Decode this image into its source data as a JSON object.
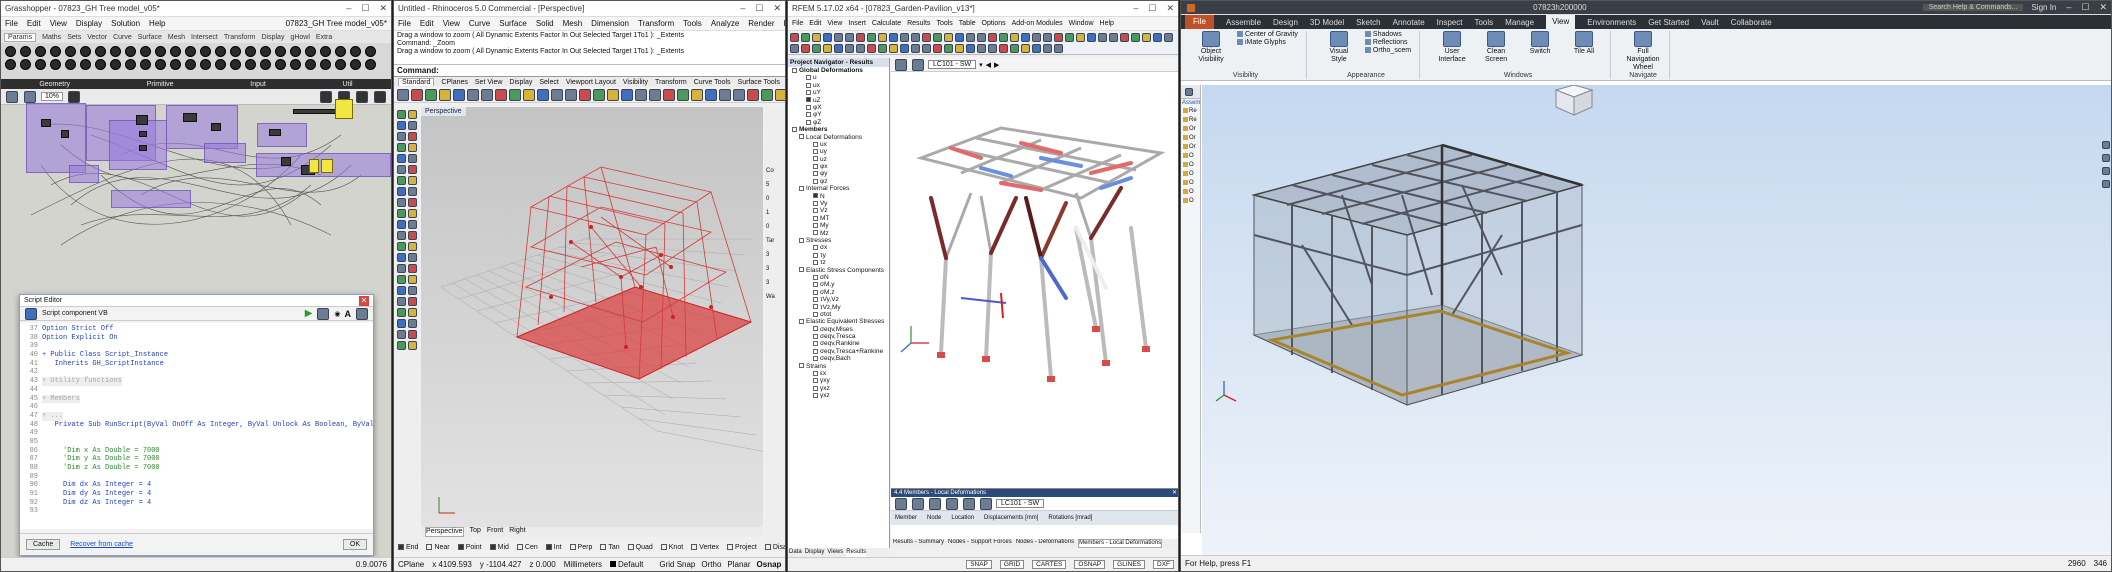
{
  "gh": {
    "title": "Grasshopper - 07823_GH Tree model_v05*",
    "doc": "07823_GH Tree model_v05*",
    "menu": [
      "File",
      "Edit",
      "View",
      "Display",
      "Solution",
      "Help"
    ],
    "tabs": [
      "Params",
      "Maths",
      "Sets",
      "Vector",
      "Curve",
      "Surface",
      "Mesh",
      "Intersect",
      "Transform",
      "Display",
      "gHowl",
      "Extra"
    ],
    "groups": [
      "Geometry",
      "Primitive",
      "Input",
      "Util"
    ],
    "zoom": "10%",
    "version": "0.9.0076"
  },
  "script": {
    "title": "Script Editor",
    "component": "Script component  VB",
    "lines": [
      {
        "n": "37",
        "t": "Option Strict Off",
        "c": ""
      },
      {
        "n": "38",
        "t": "Option Explicit On",
        "c": ""
      },
      {
        "n": "39",
        "t": "",
        "c": ""
      },
      {
        "n": "40",
        "t": "+ Public Class Script_Instance",
        "c": ""
      },
      {
        "n": "41",
        "t": "   Inherits GH_ScriptInstance",
        "c": ""
      },
      {
        "n": "42",
        "t": "",
        "c": ""
      },
      {
        "n": "43",
        "t": "+ Utility functions",
        "c": "f"
      },
      {
        "n": "44",
        "t": "",
        "c": ""
      },
      {
        "n": "45",
        "t": "+ Members",
        "c": "f"
      },
      {
        "n": "46",
        "t": "",
        "c": ""
      },
      {
        "n": "47",
        "t": "+ ...",
        "c": "f"
      },
      {
        "n": "48",
        "t": "   Private Sub RunScript(ByVal OnOff As Integer, ByVal Unlock As Boolean, ByVal Clear As Boolean, By",
        "c": ""
      },
      {
        "n": "49",
        "t": "",
        "c": ""
      },
      {
        "n": "85",
        "t": "",
        "c": ""
      },
      {
        "n": "86",
        "t": "     'Dim x As Double = 7000",
        "c": "c"
      },
      {
        "n": "87",
        "t": "     'Dim y As Double = 7000",
        "c": "c"
      },
      {
        "n": "88",
        "t": "     'Dim z As Double = 7000",
        "c": "c"
      },
      {
        "n": "89",
        "t": "",
        "c": ""
      },
      {
        "n": "90",
        "t": "     Dim dx As Integer = 4",
        "c": ""
      },
      {
        "n": "91",
        "t": "     Dim dy As Integer = 4",
        "c": ""
      },
      {
        "n": "92",
        "t": "     Dim dz As Integer = 4",
        "c": ""
      },
      {
        "n": "93",
        "t": "",
        "c": ""
      }
    ],
    "cache": "Cache",
    "recover": "Recover from cache",
    "ok": "OK"
  },
  "rhino": {
    "title": "Untitled - Rhinoceros 5.0 Commercial - [Perspective]",
    "menu": [
      "File",
      "Edit",
      "View",
      "Curve",
      "Surface",
      "Solid",
      "Mesh",
      "Dimension",
      "Transform",
      "Tools",
      "Analyze",
      "Render",
      "Help"
    ],
    "cmdlines": [
      "Drag a window to zoom ( All  Dynamic  Extents  Factor  In  Out  Selected  Target  1To1 ): _Extents",
      "Command: _Zoom",
      "Drag a window to zoom ( All  Dynamic  Extents  Factor  In  Out  Selected  Target  1To1 ): _Extents"
    ],
    "command": "Command:",
    "tabs": [
      "Standard",
      "CPlanes",
      "Set View",
      "Display",
      "Select",
      "Viewport Layout",
      "Visibility",
      "Transform",
      "Curve Tools",
      "Surface Tools",
      "Solid Tools",
      "Mesh Tools",
      "Render Tools",
      "Draf"
    ],
    "viewport": "Perspective",
    "vptabs": [
      "Perspective",
      "Top",
      "Front",
      "Right"
    ],
    "osnaps": [
      {
        "l": "End",
        "on": true
      },
      {
        "l": "Near",
        "on": false
      },
      {
        "l": "Point",
        "on": true
      },
      {
        "l": "Mid",
        "on": true
      },
      {
        "l": "Cen",
        "on": false
      },
      {
        "l": "Int",
        "on": true
      },
      {
        "l": "Perp",
        "on": false
      },
      {
        "l": "Tan",
        "on": false
      },
      {
        "l": "Quad",
        "on": false
      },
      {
        "l": "Knot",
        "on": false
      },
      {
        "l": "Vertex",
        "on": false
      },
      {
        "l": "Project",
        "on": false
      },
      {
        "l": "Disable",
        "on": false
      }
    ],
    "status": {
      "cplane": "CPlane",
      "x": "x 4109.593",
      "y": "y -1104.427",
      "z": "z 0.000",
      "units": "Millimeters",
      "layer": "Default",
      "items": [
        "Grid Snap",
        "Ortho",
        "Planar",
        "Osnap",
        "SmartTrack",
        "Gumball",
        "Record History",
        "Filter"
      ]
    },
    "side": [
      "Co",
      "5",
      "0",
      "1",
      "0",
      "Tar",
      "3",
      "3",
      "3",
      "Wa"
    ]
  },
  "rfem": {
    "title": "RFEM 5.17.02 x64 - [07823_Garden-Pavilion_v13*]",
    "menu": [
      "File",
      "Edit",
      "View",
      "Insert",
      "Calculate",
      "Results",
      "Tools",
      "Table",
      "Options",
      "Add-on Modules",
      "Window",
      "Help"
    ],
    "navtitle": "Project Navigator - Results",
    "nav": [
      {
        "h": false,
        "t": "Global Deformations",
        "ind": 0,
        "on": false
      },
      {
        "h": false,
        "t": "u",
        "ind": 2,
        "on": false
      },
      {
        "h": false,
        "t": "ux",
        "ind": 2,
        "on": false
      },
      {
        "h": false,
        "t": "uY",
        "ind": 2,
        "on": false
      },
      {
        "h": false,
        "t": "uZ",
        "ind": 2,
        "on": true
      },
      {
        "h": false,
        "t": "φX",
        "ind": 2,
        "on": false
      },
      {
        "h": false,
        "t": "φY",
        "ind": 2,
        "on": false
      },
      {
        "h": false,
        "t": "φZ",
        "ind": 2,
        "on": false
      },
      {
        "h": false,
        "t": "Members",
        "ind": 0,
        "on": false
      },
      {
        "h": false,
        "t": "Local Deformations",
        "ind": 1,
        "on": false
      },
      {
        "h": false,
        "t": "ux",
        "ind": 3,
        "on": false
      },
      {
        "h": false,
        "t": "uy",
        "ind": 3,
        "on": false
      },
      {
        "h": false,
        "t": "uz",
        "ind": 3,
        "on": false
      },
      {
        "h": false,
        "t": "φx",
        "ind": 3,
        "on": false
      },
      {
        "h": false,
        "t": "φy",
        "ind": 3,
        "on": false
      },
      {
        "h": false,
        "t": "φz",
        "ind": 3,
        "on": false
      },
      {
        "h": false,
        "t": "Internal Forces",
        "ind": 1,
        "on": false
      },
      {
        "h": false,
        "t": "N",
        "ind": 3,
        "on": true
      },
      {
        "h": false,
        "t": "Vy",
        "ind": 3,
        "on": false
      },
      {
        "h": false,
        "t": "Vz",
        "ind": 3,
        "on": false
      },
      {
        "h": false,
        "t": "MT",
        "ind": 3,
        "on": false
      },
      {
        "h": false,
        "t": "My",
        "ind": 3,
        "on": false
      },
      {
        "h": false,
        "t": "Mz",
        "ind": 3,
        "on": false
      },
      {
        "h": false,
        "t": "Stresses",
        "ind": 1,
        "on": false
      },
      {
        "h": false,
        "t": "σx",
        "ind": 3,
        "on": false
      },
      {
        "h": false,
        "t": "τy",
        "ind": 3,
        "on": false
      },
      {
        "h": false,
        "t": "τz",
        "ind": 3,
        "on": false
      },
      {
        "h": false,
        "t": "Elastic Stress Components",
        "ind": 1,
        "on": false
      },
      {
        "h": false,
        "t": "σN",
        "ind": 3,
        "on": false
      },
      {
        "h": false,
        "t": "σM,y",
        "ind": 3,
        "on": false
      },
      {
        "h": false,
        "t": "σM,z",
        "ind": 3,
        "on": false
      },
      {
        "h": false,
        "t": "τVy,Vz",
        "ind": 3,
        "on": false
      },
      {
        "h": false,
        "t": "τVz,My",
        "ind": 3,
        "on": false
      },
      {
        "h": false,
        "t": "σtot",
        "ind": 3,
        "on": false
      },
      {
        "h": false,
        "t": "Elastic Equivalent Stresses",
        "ind": 1,
        "on": false
      },
      {
        "h": false,
        "t": "σeqv,Mises",
        "ind": 3,
        "on": false
      },
      {
        "h": false,
        "t": "σeqv,Tresca",
        "ind": 3,
        "on": false
      },
      {
        "h": false,
        "t": "σeqv,Rankine",
        "ind": 3,
        "on": false
      },
      {
        "h": false,
        "t": "σeqv,Tresca+Rankine",
        "ind": 3,
        "on": false
      },
      {
        "h": false,
        "t": "σeqv,Bach",
        "ind": 3,
        "on": false
      },
      {
        "h": false,
        "t": "Strains",
        "ind": 1,
        "on": false
      },
      {
        "h": false,
        "t": "εx",
        "ind": 3,
        "on": false
      },
      {
        "h": false,
        "t": "γxy",
        "ind": 3,
        "on": false
      },
      {
        "h": false,
        "t": "γxz",
        "ind": 3,
        "on": false
      },
      {
        "h": false,
        "t": "γxz",
        "ind": 3,
        "on": false
      }
    ],
    "lc": "LC101 - SW",
    "tabletitle": "4.4 Members - Local Deformations",
    "tablelc": "LC101 - SW",
    "tablecols": [
      "Member",
      "Node",
      "Location",
      "Displacements [mm]",
      "Rotations [mrad]"
    ],
    "tabletabs": [
      "Results - Summary",
      "Nodes - Support Forces",
      "Nodes - Deformations",
      "Members - Local Deformations"
    ],
    "navtabs": [
      "Data",
      "Display",
      "Views",
      "Results"
    ],
    "status": [
      "SNAP",
      "GRID",
      "CARTES",
      "OSNAP",
      "GLINES",
      "DXF"
    ]
  },
  "nw": {
    "title": "07823h200000",
    "search": "Search Help & Commands...",
    "signin": "Sign In",
    "tabs": [
      "File",
      "Home",
      "Viewpoint",
      "Review",
      "Animation",
      "View",
      "Output",
      "BIM 360",
      "Render"
    ],
    "ribtabs": [
      "Assemble",
      "Design",
      "3D Model",
      "Sketch",
      "Annotate",
      "Inspect",
      "Tools",
      "Manage",
      "View",
      "Environments",
      "Get Started",
      "Vault",
      "Collaborate"
    ],
    "activetab": "View",
    "groups": [
      {
        "label": "Visibility",
        "buttons": [
          "Object Visibility"
        ],
        "small": [
          "Center of Gravity",
          "iMate Glyphs"
        ]
      },
      {
        "label": "Appearance",
        "buttons": [
          "Visual Style"
        ],
        "small": [
          "Shadows",
          "Reflections",
          "Ortho_scem"
        ]
      },
      {
        "label": "Windows",
        "buttons": [
          "User Interface",
          "Clean Screen",
          "Switch",
          "Tile All"
        ],
        "small": []
      },
      {
        "label": "Navigate",
        "buttons": [
          "Full Navigation Wheel"
        ],
        "small": []
      }
    ],
    "treelabel": "Assem",
    "tree": [
      "Re",
      "Re",
      "Or",
      "Or",
      "Or",
      "O",
      "O",
      "O",
      "O",
      "O",
      "O"
    ],
    "status": "For Help, press F1",
    "coords": [
      "2960",
      "346"
    ]
  }
}
